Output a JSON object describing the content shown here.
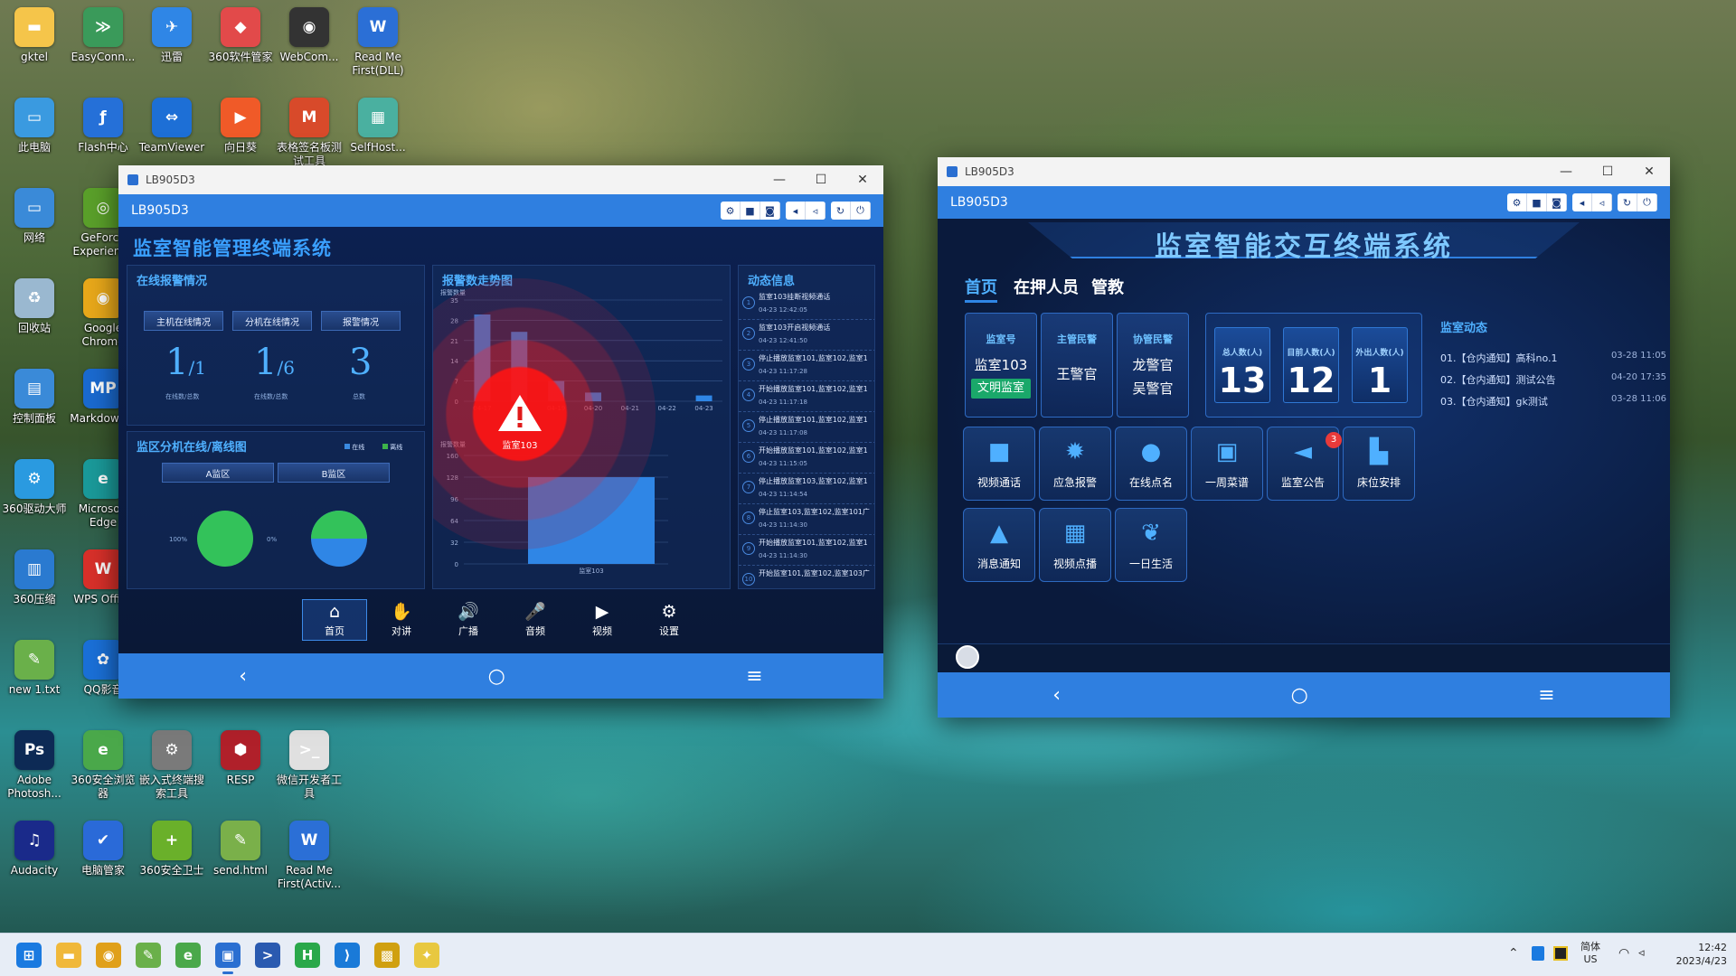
{
  "desktop": {
    "icons": [
      {
        "label": "gktel",
        "icon": "folder-icon",
        "color": "#f5c54a",
        "glyph": "▬"
      },
      {
        "label": "EasyConn...",
        "icon": "easyconnect-icon",
        "color": "#3a9a5a",
        "glyph": "≫"
      },
      {
        "label": "迅雷",
        "icon": "thunder-icon",
        "color": "#2f86e6",
        "glyph": "✈"
      },
      {
        "label": "360软件管家",
        "icon": "360-soft-icon",
        "color": "#e24a4a",
        "glyph": "◆"
      },
      {
        "label": "WebCom...",
        "icon": "webcam-icon",
        "color": "#333333",
        "glyph": "◉"
      },
      {
        "label": "Read Me First(DLL)",
        "icon": "word-doc-icon",
        "color": "#2b6fd6",
        "glyph": "W"
      },
      {
        "label": "此电脑",
        "icon": "computer-icon",
        "color": "#3a9ae0",
        "glyph": "▭"
      },
      {
        "label": "Flash中心",
        "icon": "flash-icon",
        "color": "#2570d8",
        "glyph": "ƒ"
      },
      {
        "label": "TeamViewer",
        "icon": "teamviewer-icon",
        "color": "#1d6fd6",
        "glyph": "⇔"
      },
      {
        "label": "向日葵",
        "icon": "sunlogin-icon",
        "color": "#f05a28",
        "glyph": "▶"
      },
      {
        "label": "表格签名板测试工具",
        "icon": "office-tool-icon",
        "color": "#d84a2a",
        "glyph": "M"
      },
      {
        "label": "SelfHost...",
        "icon": "selfhost-icon",
        "color": "#4ab0a0",
        "glyph": "▦"
      },
      {
        "label": "网络",
        "icon": "network-icon",
        "color": "#3a8ad8",
        "glyph": "▭"
      },
      {
        "label": "GeForce Experience",
        "icon": "geforce-icon",
        "color": "#5aa02a",
        "glyph": "◎"
      },
      {
        "label": "回收站",
        "icon": "recycle-bin-icon",
        "color": "#9ab8d0",
        "glyph": "♻"
      },
      {
        "label": "Google Chrome",
        "icon": "chrome-icon",
        "color": "#e8a81a",
        "glyph": "◉"
      },
      {
        "label": "控制面板",
        "icon": "control-panel-icon",
        "color": "#3a8ad8",
        "glyph": "▤"
      },
      {
        "label": "Markdown 2",
        "icon": "markdown-icon",
        "color": "#1a6ad0",
        "glyph": "MP"
      },
      {
        "label": "360驱动大师",
        "icon": "360-driver-icon",
        "color": "#2a9ae0",
        "glyph": "⚙"
      },
      {
        "label": "Microsoft Edge",
        "icon": "edge-icon",
        "color": "#1a9a9a",
        "glyph": "e"
      },
      {
        "label": "360压缩",
        "icon": "360-zip-icon",
        "color": "#2a7ad0",
        "glyph": "▥"
      },
      {
        "label": "WPS Office",
        "icon": "wps-icon",
        "color": "#d8302a",
        "glyph": "W"
      },
      {
        "label": "new 1.txt",
        "icon": "notepad-icon",
        "color": "#6ab04a",
        "glyph": "✎"
      },
      {
        "label": "QQ影音",
        "icon": "qq-player-icon",
        "color": "#1a70d8",
        "glyph": "✿"
      },
      {
        "label": "Adobe Photosh...",
        "icon": "photoshop-icon",
        "color": "#0d2a55",
        "glyph": "Ps"
      },
      {
        "label": "360安全浏览器",
        "icon": "360-browser-icon",
        "color": "#4aa84a",
        "glyph": "e"
      },
      {
        "label": "嵌入式终端搜索工具",
        "icon": "embedded-tool-icon",
        "color": "#7a7a7a",
        "glyph": "⚙"
      },
      {
        "label": "RESP",
        "icon": "resp-icon",
        "color": "#b0202a",
        "glyph": "⬢"
      },
      {
        "label": "微信开发者工具",
        "icon": "wechat-dev-icon",
        "color": "#e0e0e0",
        "glyph": ">_"
      },
      {
        "label": "Audacity",
        "icon": "audacity-icon",
        "color": "#1a2a8a",
        "glyph": "♫"
      },
      {
        "label": "电脑管家",
        "icon": "pc-manager-icon",
        "color": "#2a6ad8",
        "glyph": "✔"
      },
      {
        "label": "360安全卫士",
        "icon": "360-safe-icon",
        "color": "#6ab02a",
        "glyph": "+"
      },
      {
        "label": "send.html",
        "icon": "html-file-icon",
        "color": "#7ab04a",
        "glyph": "✎"
      },
      {
        "label": "Read Me First(Activ...",
        "icon": "word-doc-icon",
        "color": "#2b6fd6",
        "glyph": "W"
      }
    ]
  },
  "win1": {
    "title": "LB905D3",
    "app_name": "LB905D3",
    "system_title": "监室智能管理终端系统",
    "online": {
      "title": "在线报警情况",
      "chips": [
        "主机在线情况",
        "分机在线情况",
        "报警情况"
      ],
      "host": {
        "num": "1",
        "den": "1",
        "label": "在线数/总数"
      },
      "ext": {
        "num": "1",
        "den": "6",
        "label": "在线数/总数"
      },
      "alarm": {
        "num": "3",
        "label": "总数"
      }
    },
    "zone": {
      "title": "监区分机在线/离线图",
      "legend_on": "在线",
      "legend_off": "离线",
      "zones": [
        "A监区",
        "B监区"
      ],
      "pct_a": "100%",
      "pct_b": "0%"
    },
    "trend": {
      "title": "报警数走势图",
      "ylabel": "报警数量",
      "y_ticks": [
        "35",
        "28",
        "21",
        "14",
        "7",
        "0"
      ],
      "x_ticks": [
        "04-17",
        "04-18",
        "04-19",
        "04-20",
        "04-21",
        "04-22",
        "04-23"
      ],
      "lower_ylabel": "报警数量",
      "lower_y_ticks": [
        "160",
        "128",
        "96",
        "64",
        "32",
        "0"
      ],
      "lower_x": "监室103",
      "alert_label": "监室103"
    },
    "news": {
      "title": "动态信息",
      "items": [
        {
          "n": "1",
          "t": "监室103挂断视频通话",
          "d": "04-23 12:42:05"
        },
        {
          "n": "2",
          "t": "监室103开启视频通话",
          "d": "04-23 12:41:50"
        },
        {
          "n": "3",
          "t": "停止播放监室101,监室102,监室1",
          "d": "04-23 11:17:28"
        },
        {
          "n": "4",
          "t": "开始播放监室101,监室102,监室1",
          "d": "04-23 11:17:18"
        },
        {
          "n": "5",
          "t": "停止播放监室101,监室102,监室1",
          "d": "04-23 11:17:08"
        },
        {
          "n": "6",
          "t": "开始播放监室101,监室102,监室1",
          "d": "04-23 11:15:05"
        },
        {
          "n": "7",
          "t": "停止播放监室103,监室102,监室1",
          "d": "04-23 11:14:54"
        },
        {
          "n": "8",
          "t": "停止监室103,监室102,监室101广",
          "d": "04-23 11:14:30"
        },
        {
          "n": "9",
          "t": "开始播放监室101,监室102,监室1",
          "d": "04-23 11:14:30"
        },
        {
          "n": "10",
          "t": "开始监室101,监室102,监室103广",
          "d": ""
        }
      ]
    },
    "tools": [
      {
        "label": "首页",
        "glyph": "⌂",
        "icon": "home-icon"
      },
      {
        "label": "对讲",
        "glyph": "✋",
        "icon": "intercom-icon"
      },
      {
        "label": "广播",
        "glyph": "🔊",
        "icon": "broadcast-icon"
      },
      {
        "label": "音频",
        "glyph": "🎤",
        "icon": "audio-icon"
      },
      {
        "label": "视频",
        "glyph": "▶",
        "icon": "video-icon"
      },
      {
        "label": "设置",
        "glyph": "⚙",
        "icon": "settings-icon"
      }
    ]
  },
  "win1_chart": {
    "type": "bar",
    "categories": [
      "04-17",
      "04-18",
      "04-19",
      "04-20",
      "04-21",
      "04-22",
      "04-23"
    ],
    "values": [
      30,
      24,
      7,
      3,
      0,
      0,
      2
    ],
    "ylim": [
      0,
      35
    ]
  },
  "win1_chart2": {
    "type": "bar",
    "categories": [
      "监室103"
    ],
    "values": [
      128
    ],
    "ylim": [
      0,
      160
    ]
  },
  "win2": {
    "title": "LB905D3",
    "app_name": "LB905D3",
    "system_title": "监室智能交互终端系统",
    "tabs": [
      "首页",
      "在押人员",
      "管教"
    ],
    "room": {
      "head": "监室号",
      "value": "监室103",
      "badge": "文明监室"
    },
    "officer": {
      "head": "主管民警",
      "value": "王警官"
    },
    "assist": {
      "head": "协管民警",
      "v1": "龙警官",
      "v2": "吴警官"
    },
    "stats": [
      {
        "head": "总人数(人)",
        "value": "13"
      },
      {
        "head": "目前人数(人)",
        "value": "12"
      },
      {
        "head": "外出人数(人)",
        "value": "1"
      }
    ],
    "functions": [
      {
        "label": "视频通话",
        "glyph": "■",
        "icon": "video-call-icon"
      },
      {
        "label": "应急报警",
        "glyph": "✹",
        "icon": "emergency-alarm-icon"
      },
      {
        "label": "在线点名",
        "glyph": "●",
        "icon": "roll-call-icon"
      },
      {
        "label": "一周菜谱",
        "glyph": "▣",
        "icon": "weekly-menu-icon"
      },
      {
        "label": "监室公告",
        "glyph": "◄",
        "icon": "announcement-icon"
      },
      {
        "label": "床位安排",
        "glyph": "▙",
        "icon": "bed-arrangement-icon"
      },
      {
        "label": "消息通知",
        "glyph": "▲",
        "icon": "notification-icon"
      },
      {
        "label": "视频点播",
        "glyph": "▦",
        "icon": "video-on-demand-icon"
      },
      {
        "label": "一日生活",
        "glyph": "❦",
        "icon": "daily-life-icon"
      }
    ],
    "announcement_badge": "3",
    "news_title": "监室动态",
    "news": [
      {
        "t": "01.【仓内通知】高科no.1",
        "d": "03-28 11:05"
      },
      {
        "t": "02.【仓内通知】测试公告",
        "d": "04-20 17:35"
      },
      {
        "t": "03.【仓内通知】gk测试",
        "d": "03-28 11:06"
      }
    ]
  },
  "taskbar": {
    "apps": [
      {
        "icon": "start-icon",
        "color": "#1a7ae0",
        "glyph": "⊞"
      },
      {
        "icon": "file-explorer-icon",
        "color": "#f0b83a",
        "glyph": "▬"
      },
      {
        "icon": "chrome-icon",
        "color": "#e0a01a",
        "glyph": "◉"
      },
      {
        "icon": "notepad-icon",
        "color": "#6ab04a",
        "glyph": "✎"
      },
      {
        "icon": "360-browser-icon",
        "color": "#4aa84a",
        "glyph": "e"
      },
      {
        "icon": "lb905d3-app-icon",
        "color": "#2a6fd1",
        "glyph": "▣"
      },
      {
        "icon": "powershell-icon",
        "color": "#2a5ab0",
        "glyph": ">"
      },
      {
        "icon": "hbuilder-icon",
        "color": "#2aa84a",
        "glyph": "H"
      },
      {
        "icon": "vscode-icon",
        "color": "#1a7ad8",
        "glyph": "⟩"
      },
      {
        "icon": "pattern-app-icon",
        "color": "#d0a010",
        "glyph": "▩"
      },
      {
        "icon": "sticky-app-icon",
        "color": "#e8c840",
        "glyph": "✦"
      }
    ],
    "ime": "简体",
    "ime_sub": "US",
    "time": "12:42",
    "date": "2023/4/23"
  }
}
